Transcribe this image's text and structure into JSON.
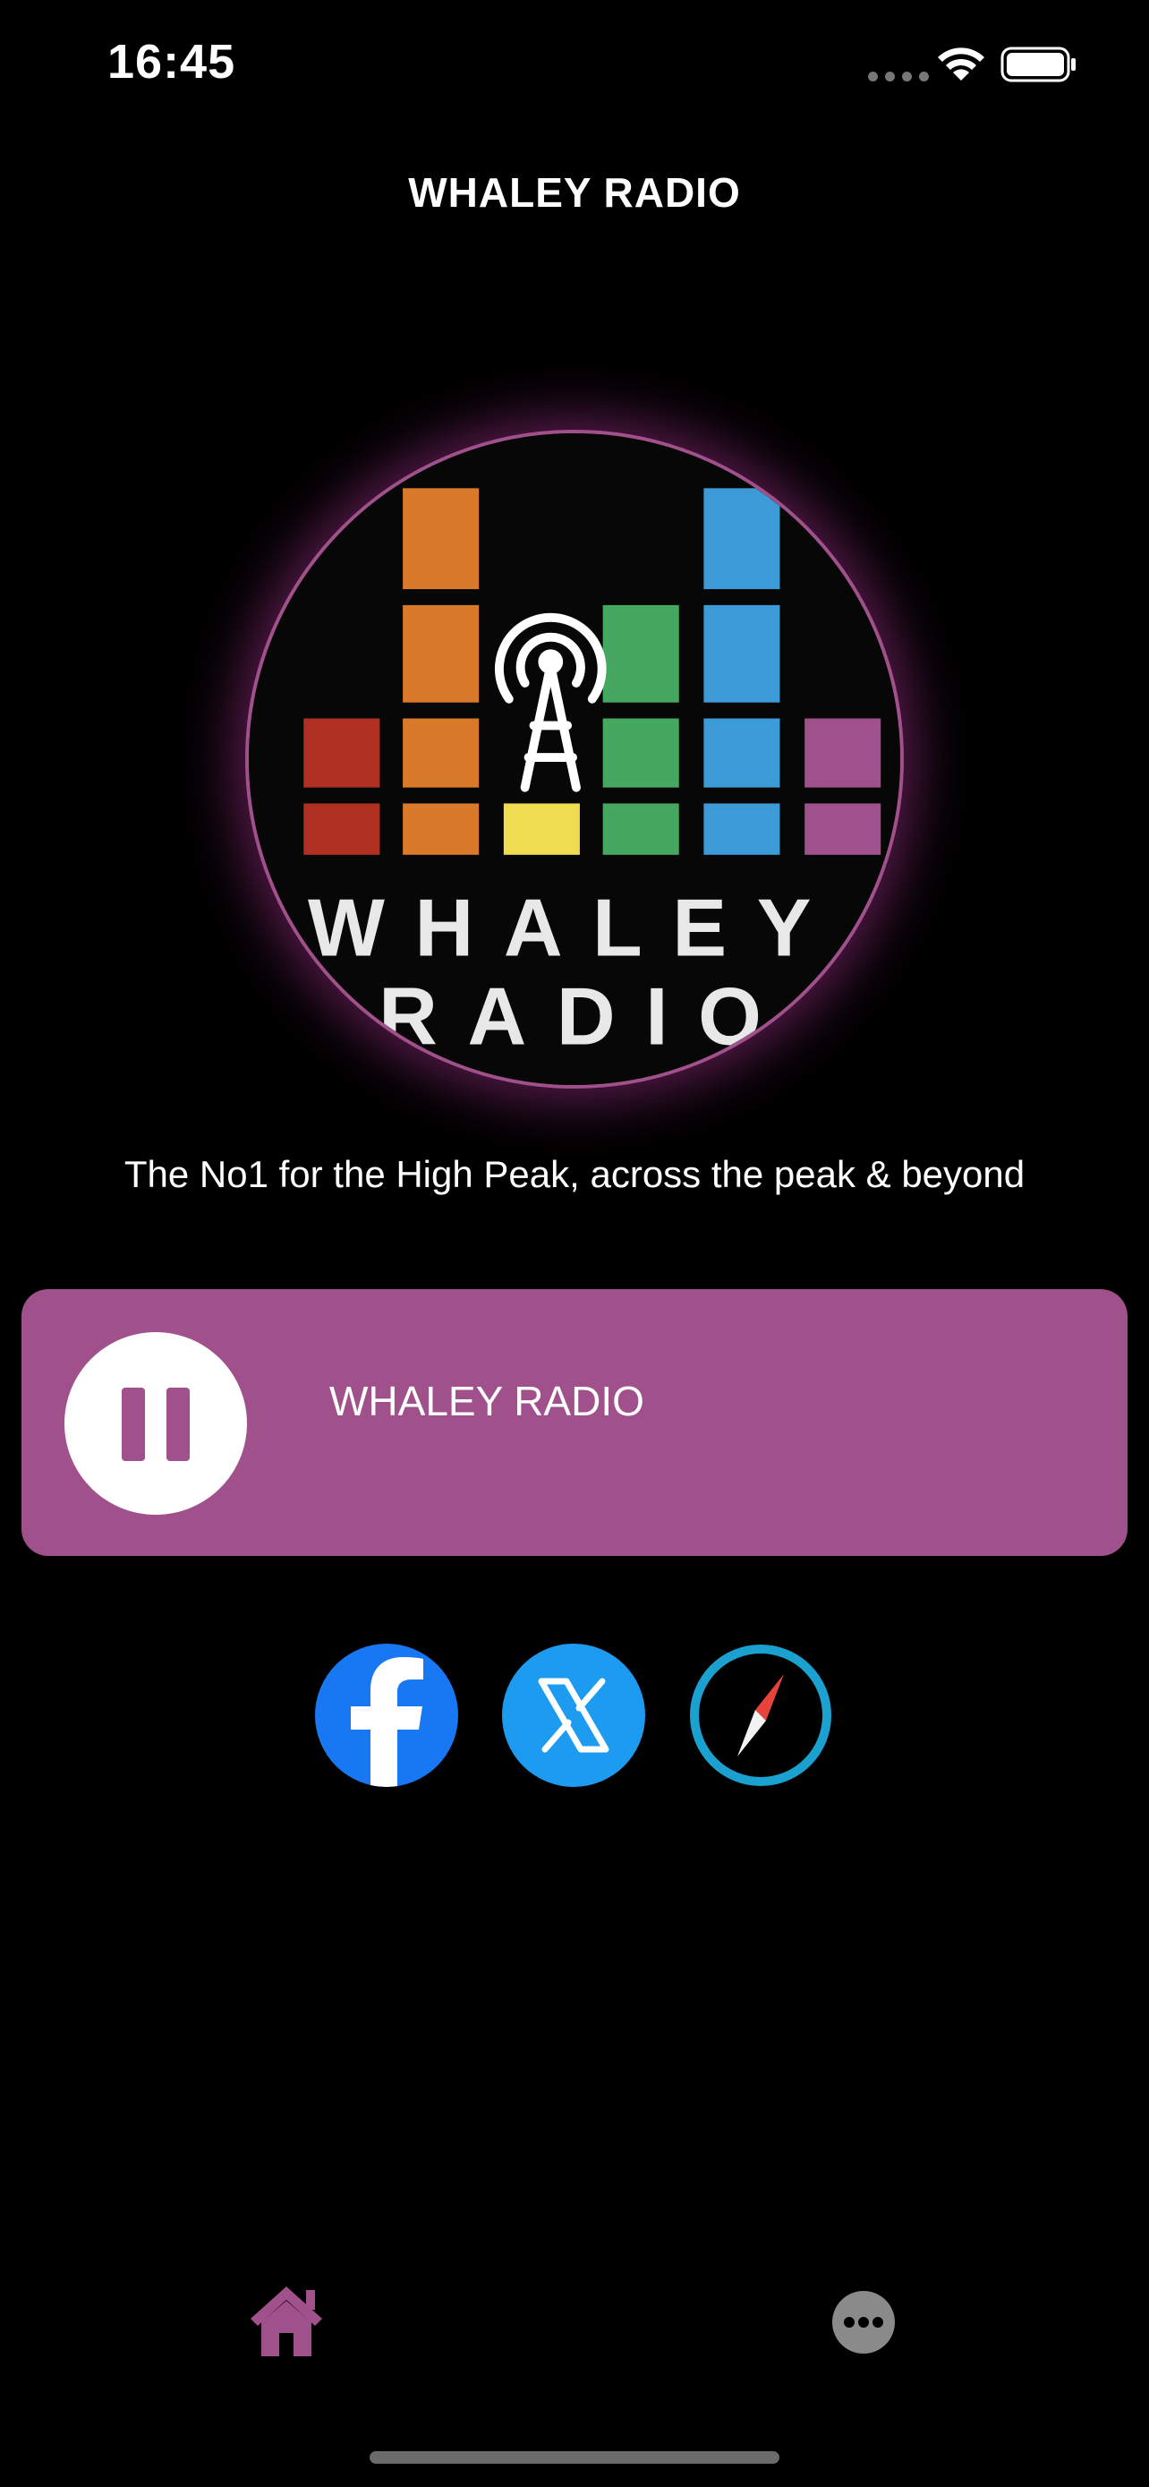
{
  "status_bar": {
    "time": "16:45"
  },
  "header": {
    "title": "WHALEY RADIO"
  },
  "logo": {
    "line1": "WHALEY",
    "line2": "RADIO"
  },
  "tagline": "The No1 for the High Peak,  across the peak & beyond",
  "player": {
    "station_name": "WHALEY RADIO",
    "state": "playing"
  },
  "social": [
    {
      "name": "Facebook",
      "icon": "facebook-icon"
    },
    {
      "name": "X",
      "icon": "x-icon"
    },
    {
      "name": "Website",
      "icon": "compass-icon"
    }
  ],
  "tab_bar": [
    {
      "name": "Home",
      "icon": "home-icon",
      "selected": true
    },
    {
      "name": "More",
      "icon": "more-icon",
      "selected": false
    }
  ],
  "colors": {
    "accent": "#a0508a",
    "background": "#000000",
    "facebook": "#1877f2",
    "twitter": "#1d9bf0",
    "safari_ring": "#1ba1cf"
  }
}
